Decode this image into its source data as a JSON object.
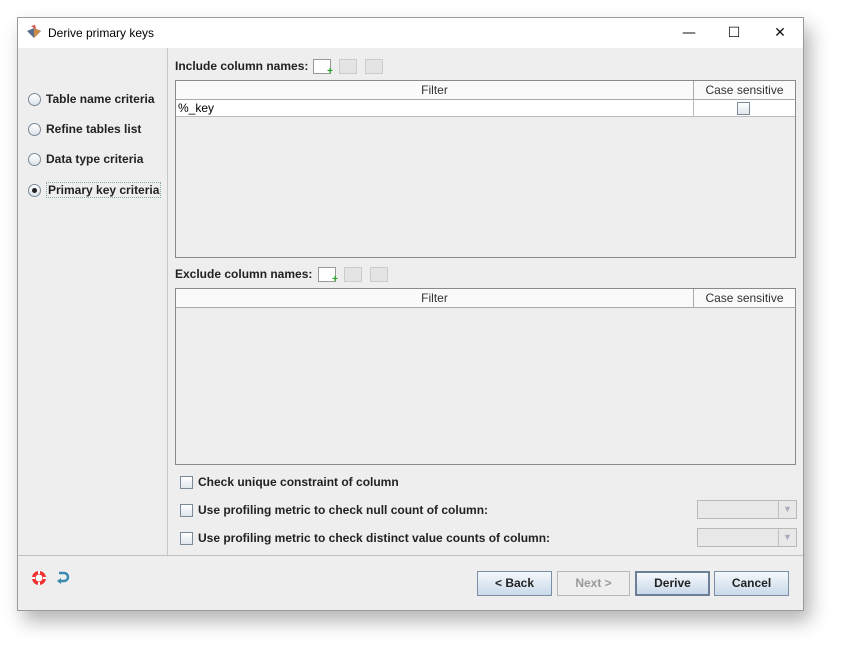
{
  "window": {
    "title": "Derive primary keys",
    "controls": [
      "minimize",
      "maximize",
      "close"
    ]
  },
  "sidebar": {
    "items": [
      {
        "label": "Table name criteria",
        "selected": false
      },
      {
        "label": "Refine tables list",
        "selected": false
      },
      {
        "label": "Data type criteria",
        "selected": false
      },
      {
        "label": "Primary key criteria",
        "selected": true
      }
    ]
  },
  "include": {
    "label": "Include column names:",
    "columns": [
      "Filter",
      "Case sensitive"
    ],
    "rows": [
      {
        "filter": "%_key",
        "case_sensitive": false
      }
    ]
  },
  "exclude": {
    "label": "Exclude column names:",
    "columns": [
      "Filter",
      "Case sensitive"
    ],
    "rows": []
  },
  "options": [
    {
      "label": "Check unique constraint of column",
      "checked": false
    },
    {
      "label": "Use profiling metric to check null count of column:",
      "checked": false
    },
    {
      "label": "Use profiling metric to check distinct value counts of column:",
      "checked": false
    }
  ],
  "buttons": {
    "back": "< Back",
    "next": "Next >",
    "derive": "Derive",
    "cancel": "Cancel"
  }
}
